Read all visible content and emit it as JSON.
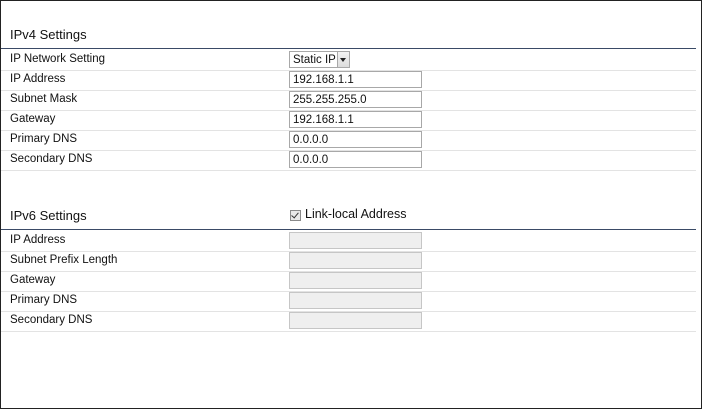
{
  "ipv4": {
    "title": "IPv4 Settings",
    "network_setting_label": "IP Network Setting",
    "network_setting_value": "Static IP",
    "ip_address_label": "IP Address",
    "ip_address_value": "192.168.1.1",
    "subnet_mask_label": "Subnet Mask",
    "subnet_mask_value": "255.255.255.0",
    "gateway_label": "Gateway",
    "gateway_value": "192.168.1.1",
    "primary_dns_label": "Primary DNS",
    "primary_dns_value": "0.0.0.0",
    "secondary_dns_label": "Secondary DNS",
    "secondary_dns_value": "0.0.0.0"
  },
  "ipv6": {
    "title": "IPv6 Settings",
    "link_local_label": "Link-local Address",
    "link_local_checked": true,
    "ip_address_label": "IP Address",
    "subnet_prefix_label": "Subnet Prefix Length",
    "gateway_label": "Gateway",
    "primary_dns_label": "Primary DNS",
    "secondary_dns_label": "Secondary DNS"
  }
}
